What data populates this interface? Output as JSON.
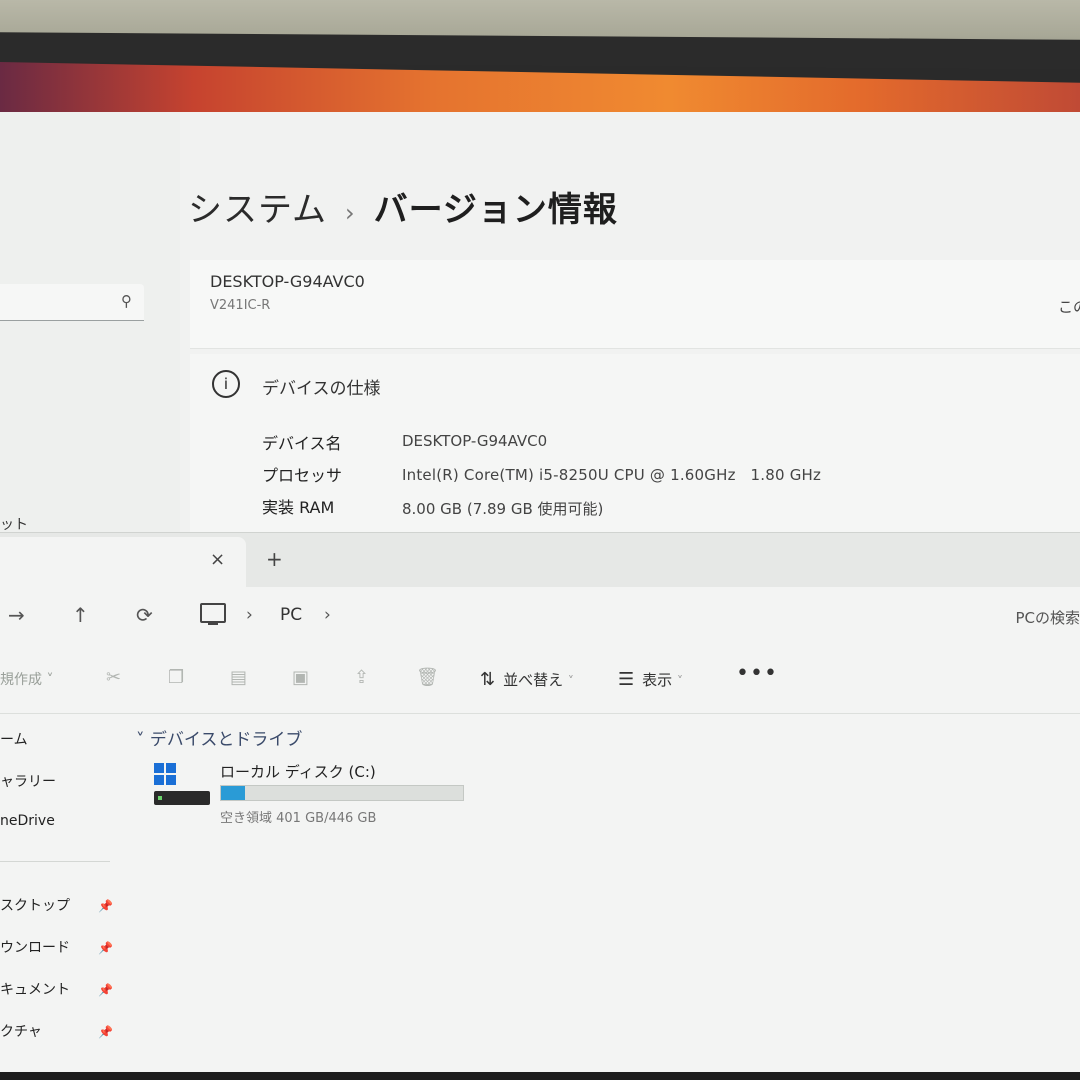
{
  "settings": {
    "breadcrumb_parent": "システム",
    "breadcrumb_sep": "›",
    "breadcrumb_current": "バージョン情報",
    "search_icon": "search-icon",
    "sidebar_cut_text": "ット",
    "device_hostname": "DESKTOP-G94AVC0",
    "device_model": "V241IC-R",
    "rename_cut": "この",
    "spec_title": "デバイスの仕様",
    "specs": [
      {
        "label": "デバイス名",
        "value": "DESKTOP-G94AVC0"
      },
      {
        "label": "プロセッサ",
        "value": "Intel(R) Core(TM) i5-8250U CPU @ 1.60GHz   1.80 GHz"
      },
      {
        "label": "実装 RAM",
        "value": "8.00 GB (7.89 GB 使用可能)"
      }
    ]
  },
  "explorer": {
    "tab_close": "×",
    "tab_new": "+",
    "nav_forward": "→",
    "nav_up": "↑",
    "nav_refresh": "⟳",
    "addr_sep1": "›",
    "addr_pc": "PC",
    "addr_sep2": "›",
    "search_cut": "PCの検索",
    "cmd_new": "規作成 ˅",
    "cmd_sort": "並べ替え",
    "cmd_sort_chev": "˅",
    "cmd_view": "表示",
    "cmd_view_chev": "˅",
    "cmd_more": "•••",
    "nav_items": [
      {
        "label": "ーム",
        "pinned": false
      },
      {
        "label": "ャラリー",
        "pinned": false
      },
      {
        "label": "neDrive",
        "pinned": false
      },
      {
        "label": "スクトップ",
        "pinned": true
      },
      {
        "label": "ウンロード",
        "pinned": true
      },
      {
        "label": "キュメント",
        "pinned": true
      },
      {
        "label": "クチャ",
        "pinned": true
      }
    ],
    "group_title": "˅ デバイスとドライブ",
    "drive": {
      "name": "ローカル ディスク (C:)",
      "free_text": "空き領域 401 GB/446 GB",
      "used_fraction": 0.1
    }
  },
  "colors": {
    "accent": "#2a9bd6",
    "windows_blue": "#1a6fd6"
  }
}
